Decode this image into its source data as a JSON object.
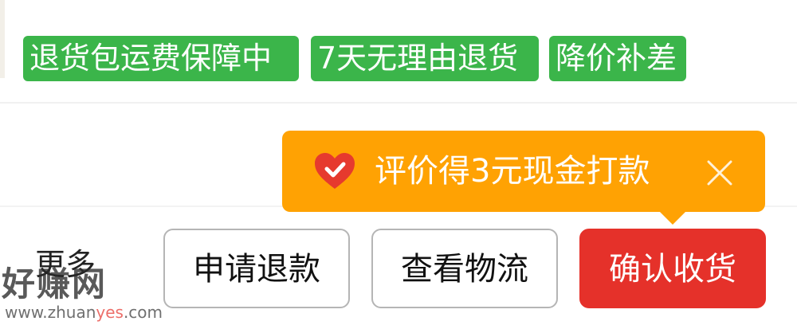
{
  "tags": [
    {
      "label": "退货包运费保障中"
    },
    {
      "label": "7天无理由退货"
    },
    {
      "label": "降价补差"
    }
  ],
  "tooltip": {
    "text": "评价得3元现金打款",
    "icon": "heart-check-icon",
    "close_icon": "close-icon"
  },
  "actions": {
    "more_label": "更多",
    "buttons": [
      {
        "label": "申请退款"
      },
      {
        "label": "查看物流"
      },
      {
        "label": "确认收货"
      }
    ]
  },
  "watermark": {
    "logo": "好赚网",
    "url_prefix": "www.zhuan",
    "url_accent": "yes",
    "url_suffix": ".com"
  },
  "colors": {
    "tag_green": "#3bb54a",
    "tooltip_orange": "#ffa203",
    "primary_red": "#e5312a",
    "outline_border": "#b5b5b5"
  }
}
